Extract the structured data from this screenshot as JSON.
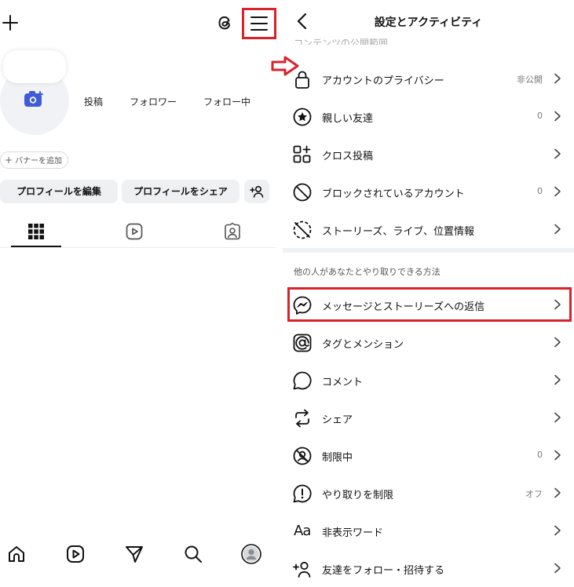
{
  "profile": {
    "stats": {
      "posts": "投稿",
      "followers": "フォロワー",
      "following": "フォロー中"
    },
    "banner_chip": {
      "plus": "+",
      "label": "バナーを追加"
    },
    "buttons": {
      "edit": "プロフィールを編集",
      "share": "プロフィールをシェア"
    },
    "icons": {
      "top_left": "plus-icon",
      "threads": "threads-icon",
      "menu": "hamburger-menu-icon",
      "avatar_camera": "camera-plus-icon",
      "add_person": "add-person-icon",
      "tab_grid": "grid-icon",
      "tab_reels": "reels-icon",
      "tab_tagged": "tagged-person-icon"
    },
    "bottom_nav": [
      "home-icon",
      "reels-icon",
      "send-icon",
      "search-icon",
      "profile-avatar-icon"
    ]
  },
  "settings": {
    "title": "設定とアクティビティ",
    "back_icon": "chevron-left-icon",
    "cut_off_label": "コンテンツの公開範囲",
    "group1": [
      {
        "icon": "lock-icon",
        "label": "アカウントのプライバシー",
        "value": "非公開"
      },
      {
        "icon": "star-circle-icon",
        "label": "親しい友達",
        "value": "0"
      },
      {
        "icon": "cross-post-icon",
        "label": "クロス投稿",
        "value": ""
      },
      {
        "icon": "block-icon",
        "label": "ブロックされているアカウント",
        "value": "0"
      },
      {
        "icon": "hide-story-icon",
        "label": "ストーリーズ、ライブ、位置情報",
        "value": ""
      }
    ],
    "section2_label": "他の人があなたとやり取りできる方法",
    "group2": [
      {
        "icon": "messenger-icon",
        "label": "メッセージとストーリーズへの返信",
        "value": ""
      },
      {
        "icon": "at-sign-icon",
        "label": "タグとメンション",
        "value": ""
      },
      {
        "icon": "comment-icon",
        "label": "コメント",
        "value": ""
      },
      {
        "icon": "share-arrows-icon",
        "label": "シェア",
        "value": ""
      },
      {
        "icon": "restricted-icon",
        "label": "制限中",
        "value": "0"
      },
      {
        "icon": "limit-interactions-icon",
        "label": "やり取りを制限",
        "value": "オフ"
      },
      {
        "icon": "hidden-words-icon",
        "label": "非表示ワード",
        "value": ""
      },
      {
        "icon": "follow-invite-icon",
        "label": "友達をフォロー・招待する",
        "value": ""
      }
    ],
    "hidden_words_glyph": "Aa"
  },
  "annotations": {
    "highlight_color": "#d8232a",
    "arrow_icon": "red-arrow-icon"
  }
}
